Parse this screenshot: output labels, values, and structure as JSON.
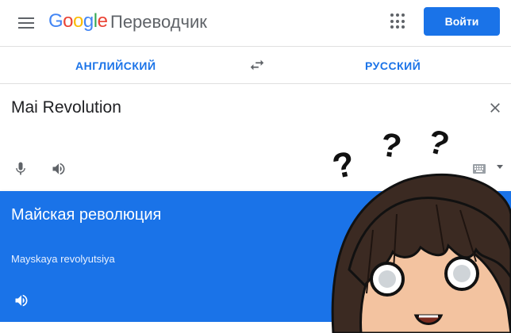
{
  "header": {
    "logo_letters": [
      "G",
      "o",
      "o",
      "g",
      "l",
      "e"
    ],
    "product": "Переводчик",
    "signin_label": "Войти"
  },
  "languages": {
    "source": "АНГЛИЙСКИЙ",
    "target": "РУССКИЙ"
  },
  "source": {
    "text": "Mai Revolution"
  },
  "result": {
    "text": "Майская революция",
    "transliteration": "Mayskaya revolyutsiya"
  },
  "overlay": {
    "marks": [
      "?",
      "?",
      "?"
    ]
  },
  "colors": {
    "accent": "#1a73e8",
    "icon": "#5f6368"
  }
}
